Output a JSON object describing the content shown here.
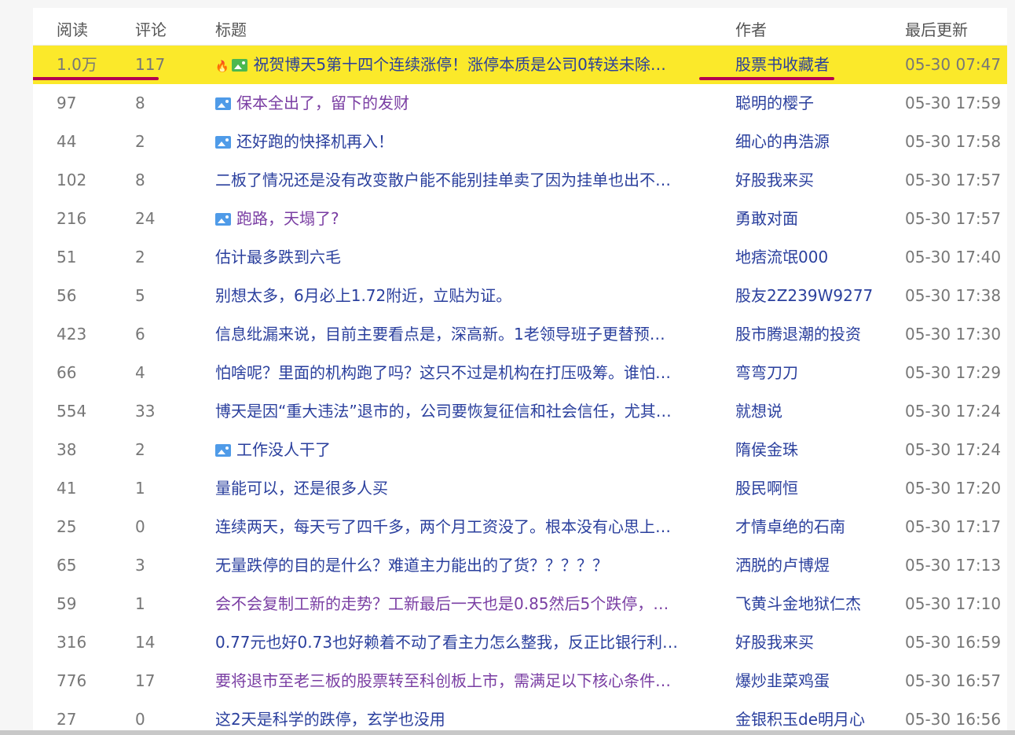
{
  "headers": {
    "read": "阅读",
    "comment": "评论",
    "title": "标题",
    "author": "作者",
    "updated": "最后更新"
  },
  "rows": [
    {
      "read": "1.0万",
      "comment": "117",
      "title": "祝贺博天5第十四个连续涨停！涨停本质是公司0转送未除…",
      "author": "股票书收藏者",
      "time": "05-30 07:47",
      "icon": "hot-image",
      "highlight": true
    },
    {
      "read": "97",
      "comment": "8",
      "title": "保本全出了，留下的发财",
      "author": "聪明的樱子",
      "time": "05-30 17:59",
      "icon": "image",
      "visited": true
    },
    {
      "read": "44",
      "comment": "2",
      "title": "还好跑的快择机再入！",
      "author": "细心的冉浩源",
      "time": "05-30 17:58",
      "icon": "image"
    },
    {
      "read": "102",
      "comment": "8",
      "title": "二板了情况还是没有改变散户能不能别挂单卖了因为挂单也出不…",
      "author": "好股我来买",
      "time": "05-30 17:57",
      "icon": ""
    },
    {
      "read": "216",
      "comment": "24",
      "title": "跑路，天塌了?",
      "author": "勇敢对面",
      "time": "05-30 17:57",
      "icon": "image",
      "visited": true
    },
    {
      "read": "51",
      "comment": "2",
      "title": "估计最多跌到六毛",
      "author": "地痞流氓000",
      "time": "05-30 17:40",
      "icon": ""
    },
    {
      "read": "56",
      "comment": "5",
      "title": "别想太多，6月必上1.72附近，立贴为证。",
      "author": "股友2Z239W9277",
      "time": "05-30 17:38",
      "icon": ""
    },
    {
      "read": "423",
      "comment": "6",
      "title": "信息纰漏来说，目前主要看点是，深高新。1老领导班子更替预…",
      "author": "股市腾退潮的投资",
      "time": "05-30 17:30",
      "icon": ""
    },
    {
      "read": "66",
      "comment": "4",
      "title": "怕啥呢？里面的机构跑了吗？这只不过是机构在打压吸筹。谁怕…",
      "author": "弯弯刀刀",
      "time": "05-30 17:29",
      "icon": ""
    },
    {
      "read": "554",
      "comment": "33",
      "title": "博天是因“重大违法”退市的，公司要恢复征信和社会信任，尤其…",
      "author": "就想说",
      "time": "05-30 17:24",
      "icon": ""
    },
    {
      "read": "38",
      "comment": "2",
      "title": "工作没人干了",
      "author": "隋侯金珠",
      "time": "05-30 17:24",
      "icon": "image"
    },
    {
      "read": "41",
      "comment": "1",
      "title": "量能可以，还是很多人买",
      "author": "股民啊恒",
      "time": "05-30 17:20",
      "icon": ""
    },
    {
      "read": "25",
      "comment": "0",
      "title": "连续两天，每天亏了四千多，两个月工资没了。根本没有心思上…",
      "author": "才情卓绝的石南",
      "time": "05-30 17:17",
      "icon": ""
    },
    {
      "read": "65",
      "comment": "3",
      "title": "无量跌停的目的是什么？难道主力能出的了货？？？？？",
      "author": "洒脱的卢博煜",
      "time": "05-30 17:13",
      "icon": ""
    },
    {
      "read": "59",
      "comment": "1",
      "title": "会不会复制工新的走势？工新最后一天也是0.85然后5个跌停，…",
      "author": "飞黄斗金地狱仁杰",
      "time": "05-30 17:10",
      "icon": "",
      "visited": true
    },
    {
      "read": "316",
      "comment": "14",
      "title": "0.77元也好0.73也好赖着不动了看主力怎么整我，反正比银行利…",
      "author": "好股我来买",
      "time": "05-30 16:59",
      "icon": ""
    },
    {
      "read": "776",
      "comment": "17",
      "title": "要将退市至老三板的股票转至科创板上市，需满足以下核心条件…",
      "author": "爆炒韭菜鸡蛋",
      "time": "05-30 16:57",
      "icon": "",
      "visited": true
    },
    {
      "read": "27",
      "comment": "0",
      "title": "这2天是科学的跌停，玄学也没用",
      "author": "金银积玉de明月心",
      "time": "05-30 16:56",
      "icon": ""
    }
  ],
  "colors": {
    "highlight": "#fbe92a",
    "underline": "#b3004f",
    "link": "#2a3f9d",
    "visited_link": "#7a3ea3"
  }
}
